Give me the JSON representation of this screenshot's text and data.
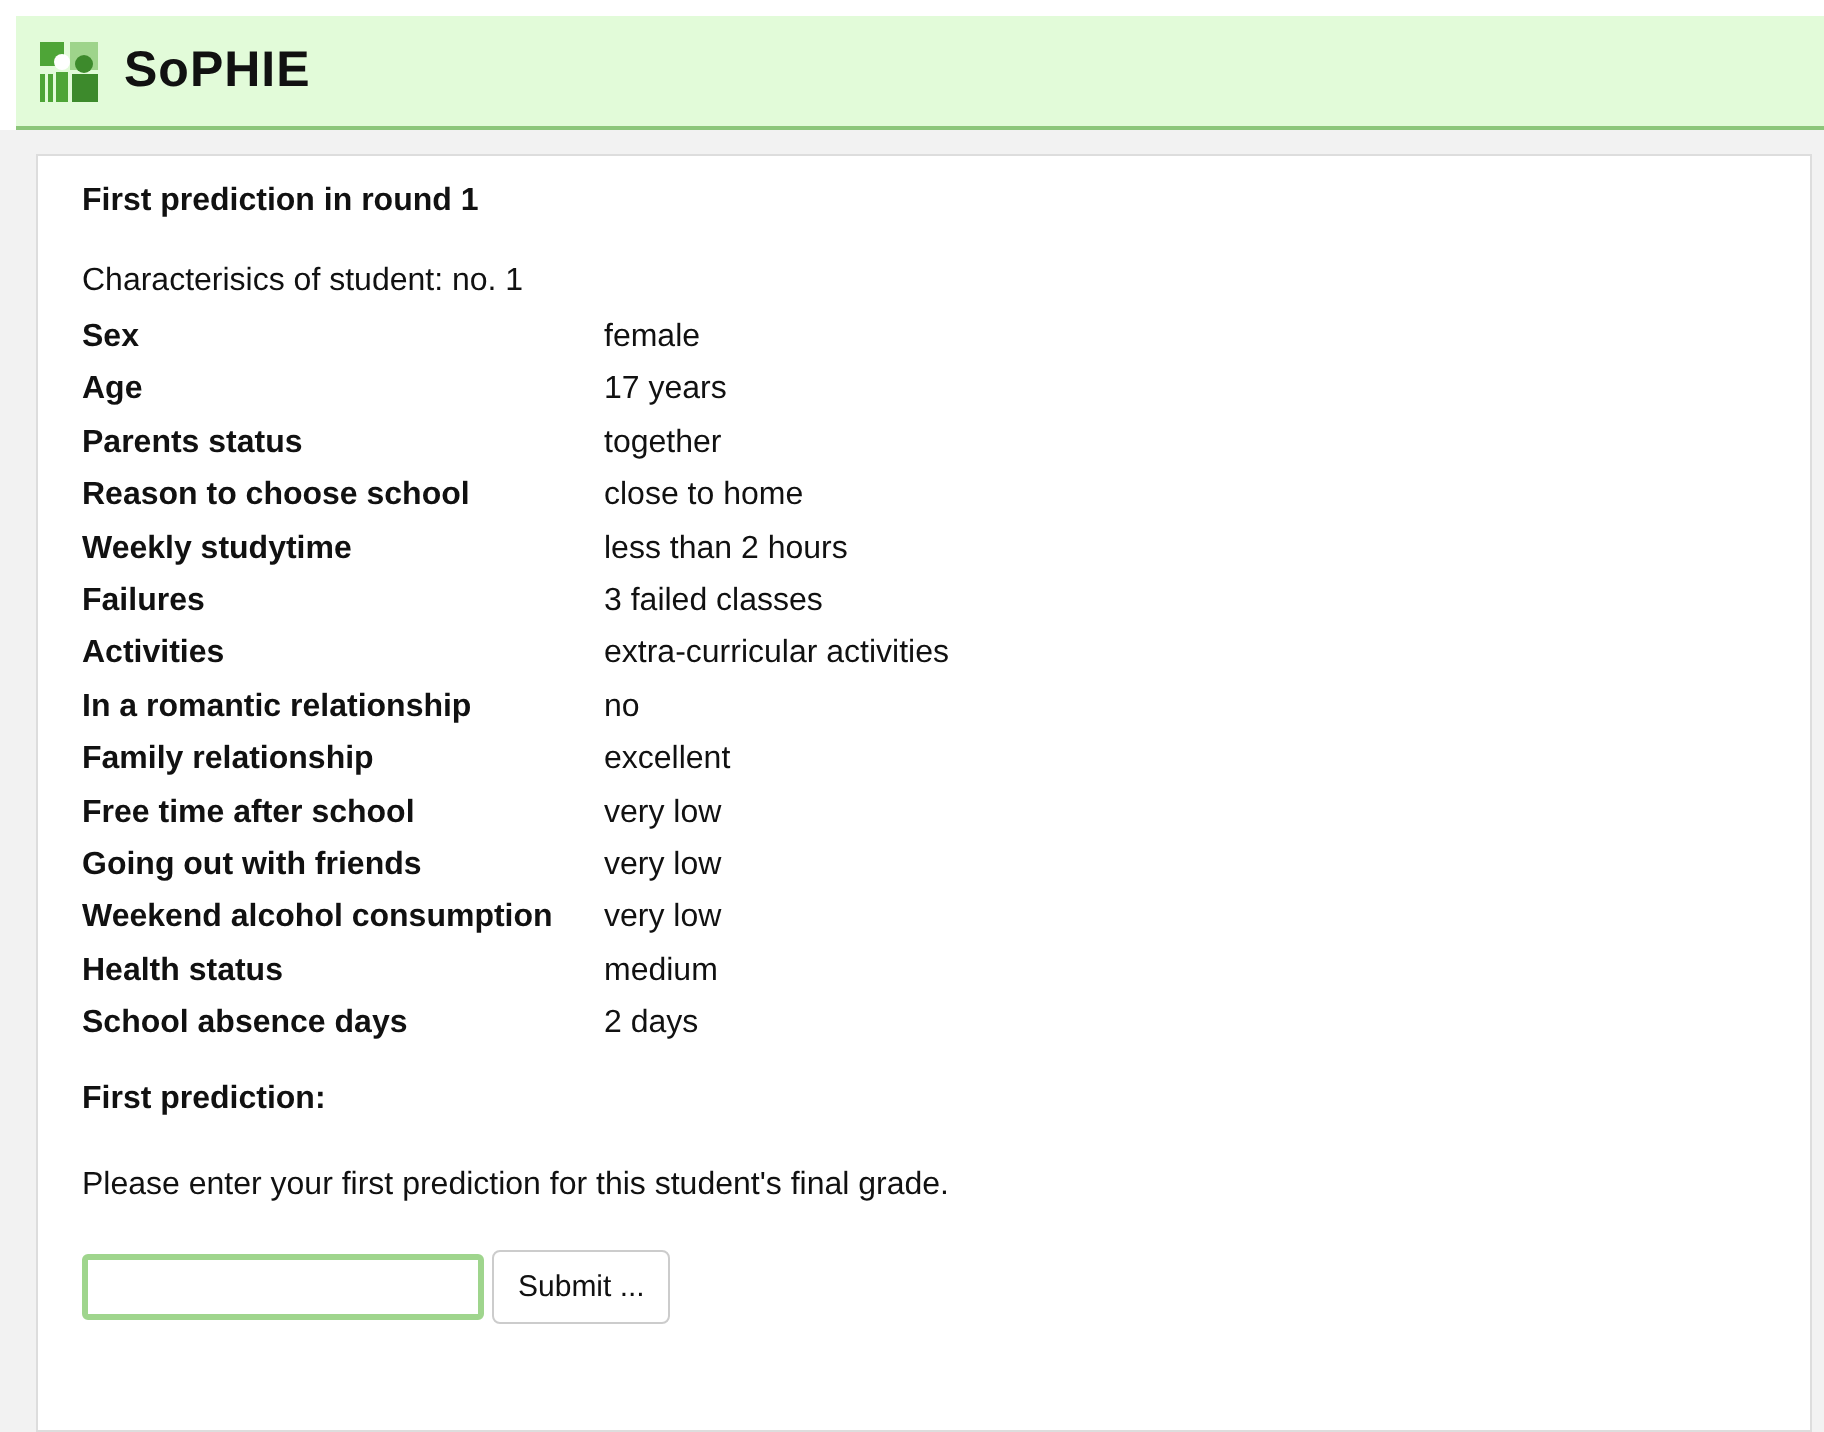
{
  "header": {
    "logo_text": "SoPHIE"
  },
  "panel": {
    "title": "First prediction in round 1",
    "intro": "Characterisics of student: no. 1",
    "attributes": [
      {
        "label": "Sex",
        "value": "female"
      },
      {
        "label": "Age",
        "value": "17 years"
      },
      {
        "label": "Parents status",
        "value": "together"
      },
      {
        "label": "Reason to choose school",
        "value": "close to home"
      },
      {
        "label": "Weekly studytime",
        "value": "less than 2 hours"
      },
      {
        "label": "Failures",
        "value": "3 failed classes"
      },
      {
        "label": "Activities",
        "value": "extra-curricular activities"
      },
      {
        "label": "In a romantic relationship",
        "value": "no"
      },
      {
        "label": "Family relationship",
        "value": "excellent"
      },
      {
        "label": "Free time after school",
        "value": "very low"
      },
      {
        "label": "Going out with friends",
        "value": "very low"
      },
      {
        "label": "Weekend alcohol consumption",
        "value": "very low"
      },
      {
        "label": "Health status",
        "value": "medium"
      },
      {
        "label": "School absence days",
        "value": "2 days"
      }
    ],
    "prediction_heading": "First prediction:",
    "instruction": "Please enter your first prediction for this student's final grade.",
    "field": {
      "focused": true
    },
    "submit": "Submit ..."
  }
}
